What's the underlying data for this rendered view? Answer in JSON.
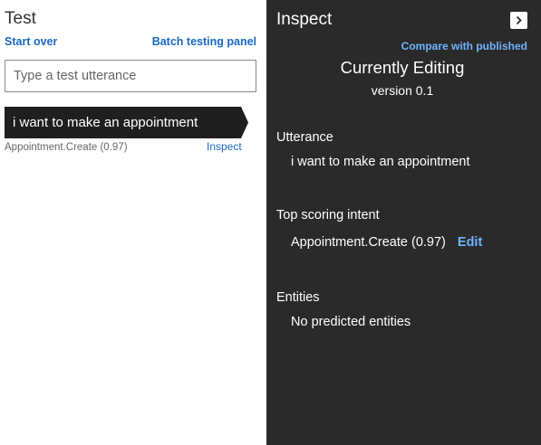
{
  "test_panel": {
    "title": "Test",
    "start_over_label": "Start over",
    "batch_testing_label": "Batch testing panel",
    "utterance_placeholder": "Type a test utterance",
    "utterances": [
      {
        "text": "i want to make an appointment",
        "intent_score": "Appointment.Create (0.97)",
        "inspect_label": "Inspect"
      }
    ]
  },
  "inspect_panel": {
    "title": "Inspect",
    "close_icon": "chevron-right-icon",
    "compare_label": "Compare with published",
    "editing_title": "Currently Editing",
    "version": "version 0.1",
    "utterance_label": "Utterance",
    "utterance_value": "i want to make an appointment",
    "top_intent_label": "Top scoring intent",
    "top_intent_value": "Appointment.Create (0.97)",
    "edit_label": "Edit",
    "entities_label": "Entities",
    "entities_value": "No predicted entities"
  },
  "colors": {
    "link": "#1b67c2",
    "dark_panel": "#2a2a2a",
    "selected_item": "#1f1f1f",
    "dark_link": "#6fb3ff"
  }
}
